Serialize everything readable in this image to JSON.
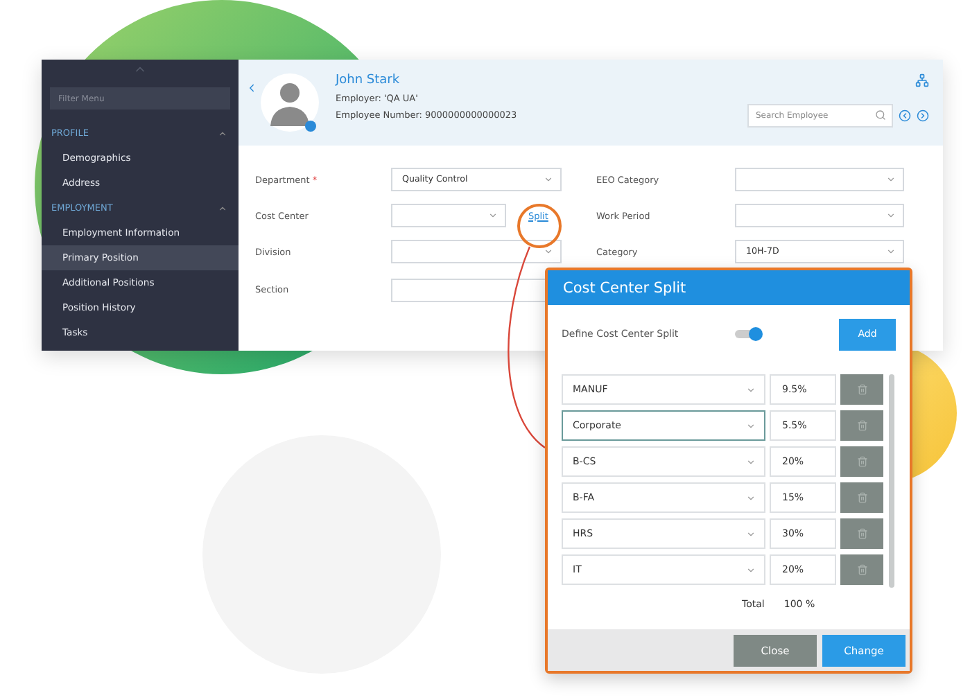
{
  "sidebar": {
    "filter_placeholder": "Filter Menu",
    "sections": [
      {
        "title": "PROFILE",
        "expanded": true,
        "items": [
          {
            "label": "Demographics",
            "selected": false
          },
          {
            "label": "Address",
            "selected": false
          }
        ]
      },
      {
        "title": "EMPLOYMENT",
        "expanded": true,
        "items": [
          {
            "label": "Employment Information",
            "selected": false
          },
          {
            "label": "Primary Position",
            "selected": true
          },
          {
            "label": "Additional Positions",
            "selected": false
          },
          {
            "label": "Position History",
            "selected": false
          },
          {
            "label": "Tasks",
            "selected": false
          }
        ]
      }
    ]
  },
  "employee": {
    "name": "John Stark",
    "employer": "Employer: 'QA UA'",
    "number": "Employee Number: 9000000000000023"
  },
  "search": {
    "placeholder": "Search Employee"
  },
  "form": {
    "left": [
      {
        "label": "Department",
        "required_mark": "*",
        "kind": "select",
        "value": "Quality Control"
      },
      {
        "label": "Cost Center",
        "kind": "select",
        "link": "Split"
      },
      {
        "label": "Division",
        "kind": "select"
      },
      {
        "label": "Section",
        "kind": "input"
      }
    ],
    "right": [
      {
        "label": "EEO Category",
        "kind": "select"
      },
      {
        "label": "Work Period",
        "kind": "select"
      },
      {
        "label": "Category",
        "kind": "select",
        "value": "10H-7D"
      }
    ]
  },
  "dialog": {
    "title": "Cost Center Split",
    "toggle_label": "Define Cost Center Split",
    "toggle_on": true,
    "add_button": "Add",
    "rows": [
      {
        "cost_center": "MANUF",
        "percent": "9.5%",
        "focused": false
      },
      {
        "cost_center": "Corporate",
        "percent": "5.5%",
        "focused": true
      },
      {
        "cost_center": "B-CS",
        "percent": "20%",
        "focused": false
      },
      {
        "cost_center": "B-FA",
        "percent": "15%",
        "focused": false
      },
      {
        "cost_center": "HRS",
        "percent": "30%",
        "focused": false
      },
      {
        "cost_center": "IT",
        "percent": "20%",
        "focused": false
      }
    ],
    "total_label": "Total",
    "total_value": "100 %",
    "buttons": [
      "Close",
      "Change"
    ]
  }
}
